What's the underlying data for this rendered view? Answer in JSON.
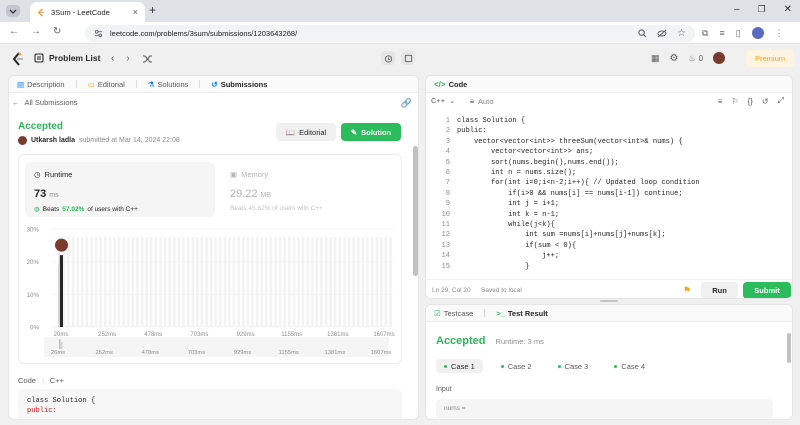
{
  "browser": {
    "tab_title": "3Sum - LeetCode",
    "url": "leetcode.com/problems/3sum/submissions/1203643268/"
  },
  "nav": {
    "problem_list": "Problem List",
    "streak": "0",
    "premium": "Premium"
  },
  "left_tabs": [
    "Description",
    "Editorial",
    "Solutions",
    "Submissions"
  ],
  "submission": {
    "back": "All Submissions",
    "status": "Accepted",
    "user": "Utkarsh ladla",
    "submitted": "submitted at Mar 14, 2024 22:08",
    "editorial_btn": "Editorial",
    "solution_btn": "Solution"
  },
  "runtime": {
    "label": "Runtime",
    "value": "73",
    "unit": "ms",
    "beats_prefix": "Beats",
    "beats_value": "57.02%",
    "beats_suffix": "of users with C++"
  },
  "memory": {
    "label": "Memory",
    "value": "29.22",
    "unit": "MB",
    "beats_text": "Beats 45.62% of users with C++"
  },
  "chart_data": {
    "type": "bar",
    "categories": [
      "20ms",
      "252ms",
      "478ms",
      "703ms",
      "929ms",
      "1155ms",
      "1381ms",
      "1607ms"
    ],
    "values": [
      22,
      0,
      0,
      0,
      0,
      0,
      0,
      0
    ],
    "y_ticks": [
      "30%",
      "20%",
      "10%",
      "0%"
    ],
    "ylim": [
      0,
      30
    ],
    "mini_categories": [
      "26ms",
      "252ms",
      "478ms",
      "703ms",
      "929ms",
      "1155ms",
      "1381ms",
      "1607ms"
    ],
    "colors": {
      "highlight": "#262626",
      "bar": "#e8e8e8"
    }
  },
  "code_section": {
    "label": "Code",
    "lang": "C++",
    "preview": [
      "class Solution {",
      "public:"
    ]
  },
  "editor": {
    "title": "Code",
    "lang": "C++",
    "mode": "Auto",
    "line_numbers": [
      "1",
      "2",
      "3",
      "4",
      "5",
      "6",
      "7",
      "8",
      "9",
      "10",
      "11",
      "12",
      "13",
      "14",
      "15"
    ],
    "lines": [
      "class Solution {",
      "public:",
      "    vector<vector<int>> threeSum(vector<int>& nums) {",
      "        vector<vector<int>> ans;",
      "        sort(nums.begin(),nums.end());",
      "        int n = nums.size();",
      "        for(int i=0;i<n-2;i++){ // Updated loop condition",
      "            if(i>0 && nums[i] == nums[i-1]) continue;",
      "            int j = i+1;",
      "            int k = n-1;",
      "            while(j<k){",
      "                int sum =nums[i]+nums[j]+nums[k];",
      "                if(sum < 0){",
      "                    j++;",
      "                }"
    ],
    "status": "Ln 29, Col 20",
    "saved": "Saved to local",
    "run": "Run",
    "submit": "Submit"
  },
  "test": {
    "tab_testcase": "Testcase",
    "tab_result": "Test Result",
    "status": "Accepted",
    "runtime": "Runtime: 3 ms",
    "cases": [
      "Case 1",
      "Case 2",
      "Case 3",
      "Case 4"
    ],
    "input_label": "Input",
    "input_value": "nums ="
  },
  "colors": {
    "accent_green": "#2cbb5d",
    "accepted": "#2db55d",
    "premium": "#ffa116"
  }
}
